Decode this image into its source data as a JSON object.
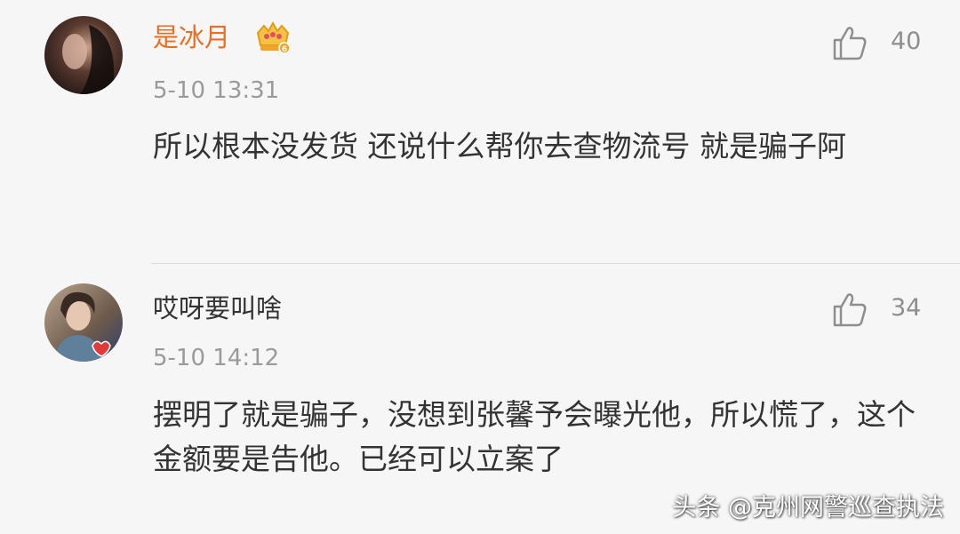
{
  "comments": [
    {
      "username": "是冰月",
      "badge_icon": "vip-crown-icon",
      "username_color": "#e86f22",
      "time": "5-10 13:31",
      "text": "所以根本没发货 还说什么帮你去查物流号 就是骗子阿",
      "likes": "40",
      "avatar": "avatar-dark-photo"
    },
    {
      "username": "哎呀要叫啥",
      "time": "5-10 14:12",
      "text": "摆明了就是骗子，没想到张馨予会曝光他，所以慌了，这个金额要是告他。已经可以立案了",
      "likes": "34",
      "avatar": "avatar-portrait-photo"
    }
  ],
  "like_icon": "thumbs-up-icon",
  "watermark": "头条 @克州网警巡查执法"
}
